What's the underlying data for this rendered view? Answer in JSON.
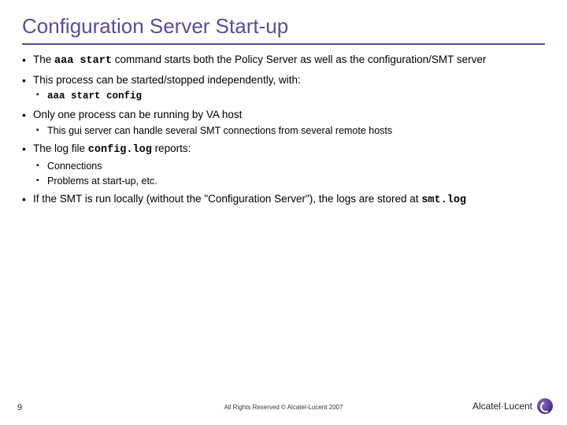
{
  "title": "Configuration Server Start-up",
  "bullets": {
    "b0_pre": "The ",
    "b0_code": "aaa start",
    "b0_post": " command starts both the Policy Server as well as the configuration/SMT server",
    "b1": "This process can be started/stopped independently, with:",
    "b1a_code": "aaa start config",
    "b2": "Only one process can be running by VA host",
    "b2a": "This gui server can handle several SMT connections from several remote hosts",
    "b3_pre": "The log file ",
    "b3_code": "config.log",
    "b3_post": " reports:",
    "b3a": "Connections",
    "b3b": "Problems at start-up, etc.",
    "b4_pre": "If the SMT is run locally (without the \"Configuration Server\"), the logs are stored at ",
    "b4_code": "smt.log"
  },
  "footer": {
    "page": "9",
    "copyright": "All Rights Reserved © Alcatel-Lucent 2007",
    "brand": "Alcatel·Lucent"
  }
}
